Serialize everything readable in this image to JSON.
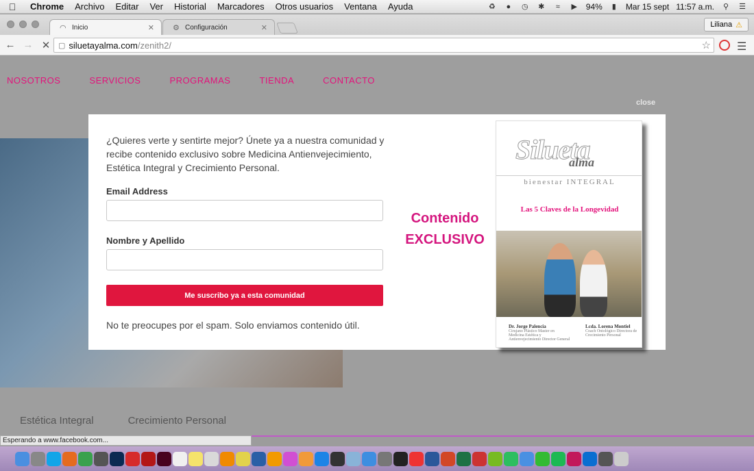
{
  "menubar": {
    "items": [
      "Chrome",
      "Archivo",
      "Editar",
      "Ver",
      "Historial",
      "Marcadores",
      "Otros usuarios",
      "Ventana",
      "Ayuda"
    ],
    "battery": "94%",
    "date": "Mar 15 sept",
    "time": "11:57 a.m."
  },
  "browser": {
    "tabs": [
      {
        "label": "Inicio"
      },
      {
        "label": "Configuración"
      }
    ],
    "user": "Liliana",
    "url_domain": "siluetayalma.com",
    "url_path": "/zenith2/"
  },
  "site": {
    "nav": [
      "NOSOTROS",
      "SERVICIOS",
      "PROGRAMAS",
      "TIENDA",
      "CONTACTO"
    ],
    "close_label": "close",
    "subnav": [
      "Estética Integral",
      "Crecimiento Personal"
    ]
  },
  "modal": {
    "intro": "¿Quieres verte y sentirte mejor? Únete ya a nuestra comunidad y recibe contenido exclusivo sobre Medicina Antienvejecimiento, Estética Integral y Crecimiento Personal.",
    "email_label": "Email Address",
    "email_value": "",
    "name_label": "Nombre y Apellido",
    "name_value": "",
    "submit_label": "Me suscribo ya a esta comunidad",
    "spam_note": "No te preocupes por el spam. Solo enviamos contenido útil.",
    "exclusive_line1": "Contenido",
    "exclusive_line2": "EXCLUSIVO"
  },
  "book": {
    "brand": "Silueta",
    "brand2": "alma",
    "tagline": "bienestar INTEGRAL",
    "title": "Las 5 Claves de la Longevidad",
    "author1_name": "Dr. Jorge Palencia",
    "author1_role": "Cirujano Plástico Master en Medicina Estética y Antienvejecimiento Director General",
    "author2_name": "Lcda. Lorena Montiel",
    "author2_role": "Coach Ontológico Directora de Crecimiento Personal"
  },
  "status_text": "Esperando a www.facebook.com...",
  "dock_icons": [
    "finder-icon",
    "launchpad-icon",
    "skype-icon",
    "firefox-icon",
    "chrome-icon",
    "scanner-icon",
    "photoshop-icon",
    "acrobat-icon",
    "acrobat-reader-icon",
    "indesign-icon",
    "calendar-icon",
    "notes-icon",
    "files-icon",
    "vlc-icon",
    "photos-icon",
    "quicktime-icon",
    "amazon-icon",
    "itunes-icon",
    "ibooks-icon",
    "appstore-icon",
    "video-icon",
    "preview-icon",
    "downloads-icon",
    "settings-icon",
    "radioactive-icon",
    "popcorn-icon",
    "word-icon",
    "powerpoint-icon",
    "excel-icon",
    "paint-icon",
    "app-icon",
    "evernote-icon",
    "globe-icon",
    "messages-icon",
    "spotify-icon",
    "screen-icon",
    "teamviewer-icon",
    "phone-icon",
    "trash-icon"
  ],
  "dock_colors": [
    "#4a8fe0",
    "#888",
    "#12a5e8",
    "#e56b1f",
    "#3aa14d",
    "#555",
    "#0a2a52",
    "#d62b2b",
    "#b31717",
    "#49021f",
    "#f0f0f0",
    "#f5e36b",
    "#d9d9d9",
    "#f08a00",
    "#e2d24b",
    "#2a5fa6",
    "#f29a00",
    "#d14fd3",
    "#f19a3a",
    "#1c84e6",
    "#333",
    "#89b3d8",
    "#3e8ee0",
    "#777",
    "#222",
    "#e33",
    "#2b579a",
    "#d24726",
    "#1e7145",
    "#c33",
    "#7b2",
    "#2dbe60",
    "#4a90e2",
    "#3b3",
    "#1db954",
    "#c2185b",
    "#0a6ed1",
    "#555",
    "#ccc"
  ]
}
